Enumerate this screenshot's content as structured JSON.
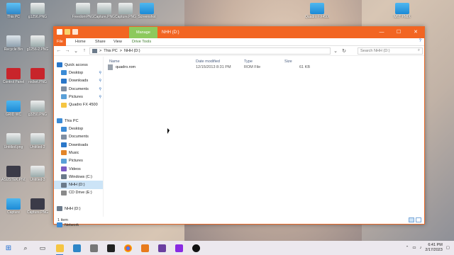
{
  "desktop": {
    "icons": [
      {
        "label": "This PC",
        "glyph": "g-pc",
        "col": 0,
        "row": 0
      },
      {
        "label": "Recycle Bin",
        "glyph": "g-bin",
        "col": 0,
        "row": 1
      },
      {
        "label": "Control Panel",
        "glyph": "g-red",
        "col": 0,
        "row": 2
      },
      {
        "label": "GRID WC",
        "glyph": "g-folder",
        "col": 0,
        "row": 3
      },
      {
        "label": "Untitled.png",
        "glyph": "g-img",
        "col": 0,
        "row": 4
      },
      {
        "label": "ASUSTEK.PNG",
        "glyph": "g-dark",
        "col": 0,
        "row": 5
      },
      {
        "label": "Capture",
        "glyph": "g-folder",
        "col": 0,
        "row": 6
      },
      {
        "label": "g1256.PNG",
        "glyph": "g-img",
        "col": 1,
        "row": 0
      },
      {
        "label": "g1256-2.PNG",
        "glyph": "g-img",
        "col": 1,
        "row": 1
      },
      {
        "label": "rocket.PNG",
        "glyph": "g-red",
        "col": 1,
        "row": 2
      },
      {
        "label": "g3250.PNG",
        "glyph": "g-img",
        "col": 1,
        "row": 3
      },
      {
        "label": "Untitled-2",
        "glyph": "g-img",
        "col": 1,
        "row": 4
      },
      {
        "label": "Untitled-3",
        "glyph": "g-img",
        "col": 1,
        "row": 5
      },
      {
        "label": "Capture.PNG",
        "glyph": "g-dark",
        "col": 1,
        "row": 6
      },
      {
        "label": "FreedomPNG",
        "glyph": "g-img",
        "col": 2,
        "row": 0
      },
      {
        "label": "Capture.PNG",
        "glyph": "g-img",
        "col": 3,
        "row": 0
      },
      {
        "label": "Capture.PNG",
        "glyph": "g-img",
        "col": 4,
        "row": 0
      },
      {
        "label": "Screenshot",
        "glyph": "g-folder",
        "col": 5,
        "row": 0
      },
      {
        "label": "Quadro FX4500",
        "glyph": "g-folder",
        "col": 13,
        "row": 0
      },
      {
        "label": "M6T PMIX",
        "glyph": "g-folder",
        "col": 17,
        "row": 0
      }
    ]
  },
  "window": {
    "title": "NHH (D:)",
    "contextual_tab": "Manage",
    "controls": {
      "minimize": "—",
      "maximize": "☐",
      "close": "✕"
    },
    "ribbon_tabs": [
      "File",
      "Home",
      "Share",
      "View",
      "Drive Tools"
    ],
    "address": {
      "root": "This PC",
      "sep": ">",
      "current": "NHH (D:)"
    },
    "search_placeholder": "Search NHH (D:)",
    "nav": [
      {
        "label": "Quick access",
        "icon": "star-icon",
        "color": "#2a77c9",
        "indent": 4,
        "pin": false
      },
      {
        "label": "Desktop",
        "icon": "desktop-icon",
        "color": "#3b8bd6",
        "indent": 10,
        "pin": true
      },
      {
        "label": "Downloads",
        "icon": "download-icon",
        "color": "#2a77c9",
        "indent": 10,
        "pin": true
      },
      {
        "label": "Documents",
        "icon": "documents-icon",
        "color": "#7f8fa3",
        "indent": 10,
        "pin": true
      },
      {
        "label": "Pictures",
        "icon": "pictures-icon",
        "color": "#5aa0d8",
        "indent": 10,
        "pin": true
      },
      {
        "label": "Quadro FX 4500",
        "icon": "folder-icon",
        "color": "#f5c542",
        "indent": 10,
        "pin": false
      },
      {
        "label": "",
        "icon": "",
        "color": "",
        "indent": 0,
        "pin": false
      },
      {
        "label": "This PC",
        "icon": "pc-icon",
        "color": "#3b8bd6",
        "indent": 4,
        "pin": false
      },
      {
        "label": "Desktop",
        "icon": "desktop-icon",
        "color": "#3b8bd6",
        "indent": 10,
        "pin": false
      },
      {
        "label": "Documents",
        "icon": "documents-icon",
        "color": "#7f8fa3",
        "indent": 10,
        "pin": false
      },
      {
        "label": "Downloads",
        "icon": "download-icon",
        "color": "#2a77c9",
        "indent": 10,
        "pin": false
      },
      {
        "label": "Music",
        "icon": "music-icon",
        "color": "#e2852a",
        "indent": 10,
        "pin": false
      },
      {
        "label": "Pictures",
        "icon": "pictures-icon",
        "color": "#5aa0d8",
        "indent": 10,
        "pin": false
      },
      {
        "label": "Videos",
        "icon": "videos-icon",
        "color": "#7b5bc4",
        "indent": 10,
        "pin": false
      },
      {
        "label": "Windows (C:)",
        "icon": "drive-icon",
        "color": "#6b7a8a",
        "indent": 10,
        "pin": false
      },
      {
        "label": "NHH (D:)",
        "icon": "drive-icon",
        "color": "#6b7a8a",
        "indent": 10,
        "pin": false,
        "selected": true
      },
      {
        "label": "CD Drive (E:)",
        "icon": "cd-icon",
        "color": "#8a8a8a",
        "indent": 10,
        "pin": false
      },
      {
        "label": "",
        "icon": "",
        "color": "",
        "indent": 0,
        "pin": false
      },
      {
        "label": "NHH (D:)",
        "icon": "drive-icon",
        "color": "#6b7a8a",
        "indent": 4,
        "pin": false
      },
      {
        "label": "",
        "icon": "",
        "color": "",
        "indent": 0,
        "pin": false
      },
      {
        "label": "Network",
        "icon": "network-icon",
        "color": "#3b8bd6",
        "indent": 4,
        "pin": false
      }
    ],
    "columns": {
      "name": "Name",
      "date": "Date modified",
      "type": "Type",
      "size": "Size"
    },
    "files": [
      {
        "name": "quadro.rom",
        "date": "12/15/2013 8:31 PM",
        "type": "ROM File",
        "size": "61 KB"
      }
    ],
    "status": "1 item"
  },
  "taskbar": {
    "time": "6:41 PM",
    "date": "2/17/2023",
    "colors": {
      "accent": "#2a77c9",
      "title": "#f26522",
      "manage": "#8dc95d"
    }
  }
}
